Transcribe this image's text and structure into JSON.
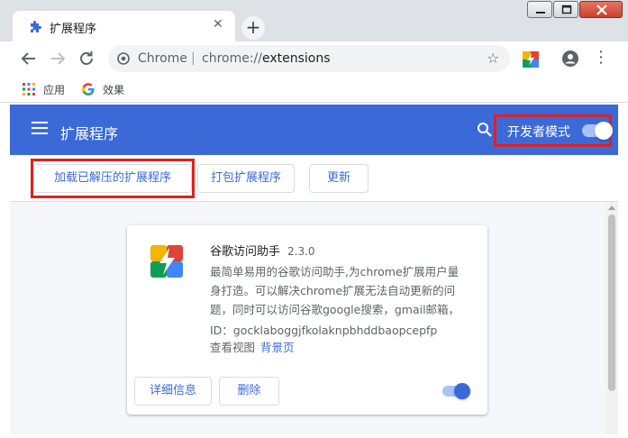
{
  "tab": {
    "title": "扩展程序",
    "favicon": "puzzle-icon"
  },
  "omnibox": {
    "scheme_label": "Chrome",
    "separator": "|",
    "url_prefix": "chrome://",
    "url_path": "extensions"
  },
  "bookmarks": [
    {
      "label": "应用",
      "icon": "apps-grid-icon"
    },
    {
      "label": "效果",
      "icon": "google-g-icon"
    }
  ],
  "header": {
    "title": "扩展程序",
    "dev_mode_label": "开发者模式",
    "dev_mode_on": true
  },
  "actions": {
    "load_unpacked": "加载已解压的扩展程序",
    "pack": "打包扩展程序",
    "update": "更新"
  },
  "extension": {
    "name": "谷歌访问助手",
    "version": "2.3.0",
    "description_lines": [
      "最简单易用的谷歌访问助手,为chrome扩展用户量",
      "身打造。可以解决chrome扩展无法自动更新的问",
      "题，同时可以访问谷歌google搜索，gmail邮箱，"
    ],
    "id_text": "ID：gocklaboggjfkolaknpbhddbaopcepfp",
    "views_label": "查看视图",
    "views_link": "背景页",
    "details_button": "详细信息",
    "remove_button": "删除",
    "enabled": true
  },
  "colors": {
    "accent": "#3b6ad8",
    "highlight": "#e02020",
    "tabstrip": "#dee1e6"
  }
}
